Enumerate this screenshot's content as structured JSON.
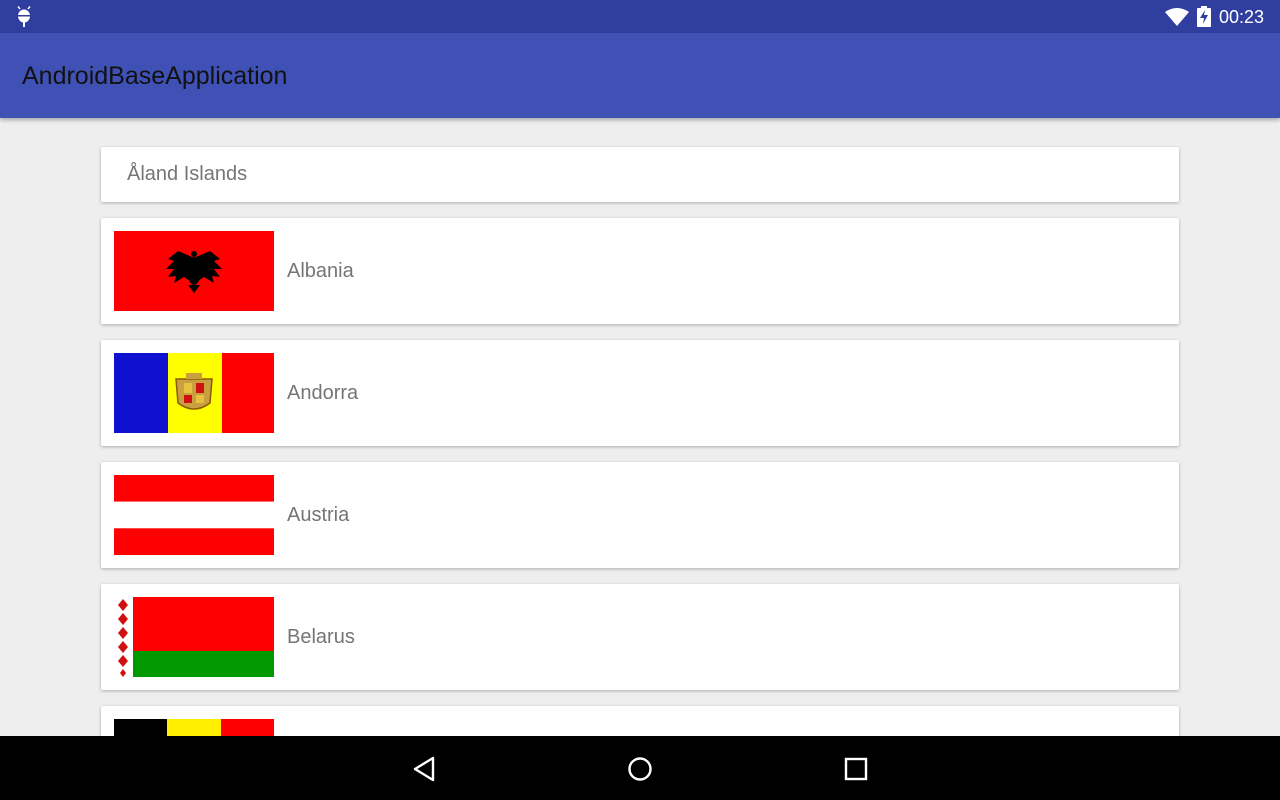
{
  "status_bar": {
    "time": "00:23",
    "icons": [
      "android-debug-icon",
      "wifi-icon",
      "battery-charging-icon"
    ]
  },
  "app_bar": {
    "title": "AndroidBaseApplication"
  },
  "list": {
    "header_item": "Åland Islands",
    "countries": [
      {
        "name": "Albania",
        "flag": "albania-flag"
      },
      {
        "name": "Andorra",
        "flag": "andorra-flag"
      },
      {
        "name": "Austria",
        "flag": "austria-flag"
      },
      {
        "name": "Belarus",
        "flag": "belarus-flag"
      },
      {
        "name": "",
        "flag": "belgium-flag"
      }
    ]
  },
  "nav_bar": {
    "buttons": [
      "back-icon",
      "home-icon",
      "recents-icon"
    ]
  },
  "colors": {
    "status_bar": "#303f9f",
    "app_bar": "#3f51b5",
    "background": "#eeeeee",
    "card": "#ffffff",
    "text": "#757575"
  }
}
